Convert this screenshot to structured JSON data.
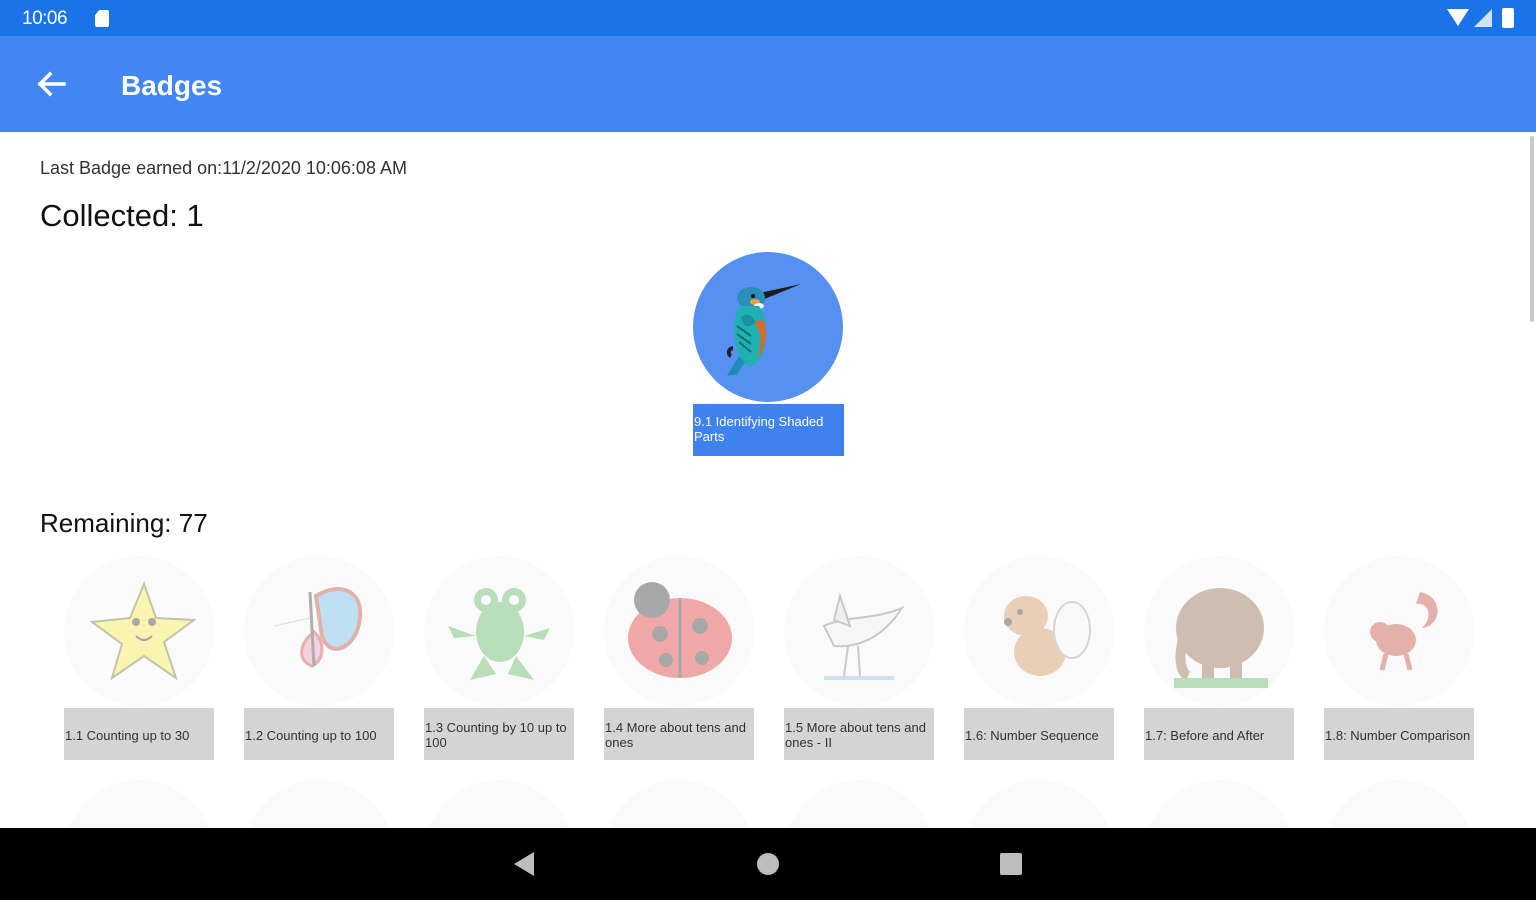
{
  "status_bar": {
    "time": "10:06",
    "icons": [
      "sd-card-icon",
      "wifi-icon",
      "signal-icon",
      "battery-icon"
    ]
  },
  "app_bar": {
    "title": "Badges",
    "back_icon": "arrow-left-icon",
    "color": "#4286f4"
  },
  "summary": {
    "last_earned": "Last Badge earned on:11/2/2020 10:06:08 AM",
    "collected": "Collected: 1",
    "remaining": "Remaining: 77"
  },
  "earned_badges": [
    {
      "label": "9.1 Identifying Shaded Parts",
      "icon": "kingfisher-icon"
    }
  ],
  "remaining_badges": [
    {
      "label": "1.1 Counting up to 30",
      "icon": "star-icon"
    },
    {
      "label": "1.2 Counting up to 100",
      "icon": "butterfly-icon"
    },
    {
      "label": "1.3 Counting by 10 up to 100",
      "icon": "frog-icon"
    },
    {
      "label": "1.4 More about tens and ones",
      "icon": "ladybug-icon"
    },
    {
      "label": "1.5 More about tens and ones - II",
      "icon": "bird-icon"
    },
    {
      "label": "1.6: Number Sequence",
      "icon": "dog-icon"
    },
    {
      "label": "1.7: Before and After",
      "icon": "elephant-icon"
    },
    {
      "label": "1.8: Number Comparison",
      "icon": "squirrel-icon"
    }
  ],
  "navigation": {
    "icons": [
      "nav-back-icon",
      "nav-home-icon",
      "nav-recents-icon"
    ]
  }
}
